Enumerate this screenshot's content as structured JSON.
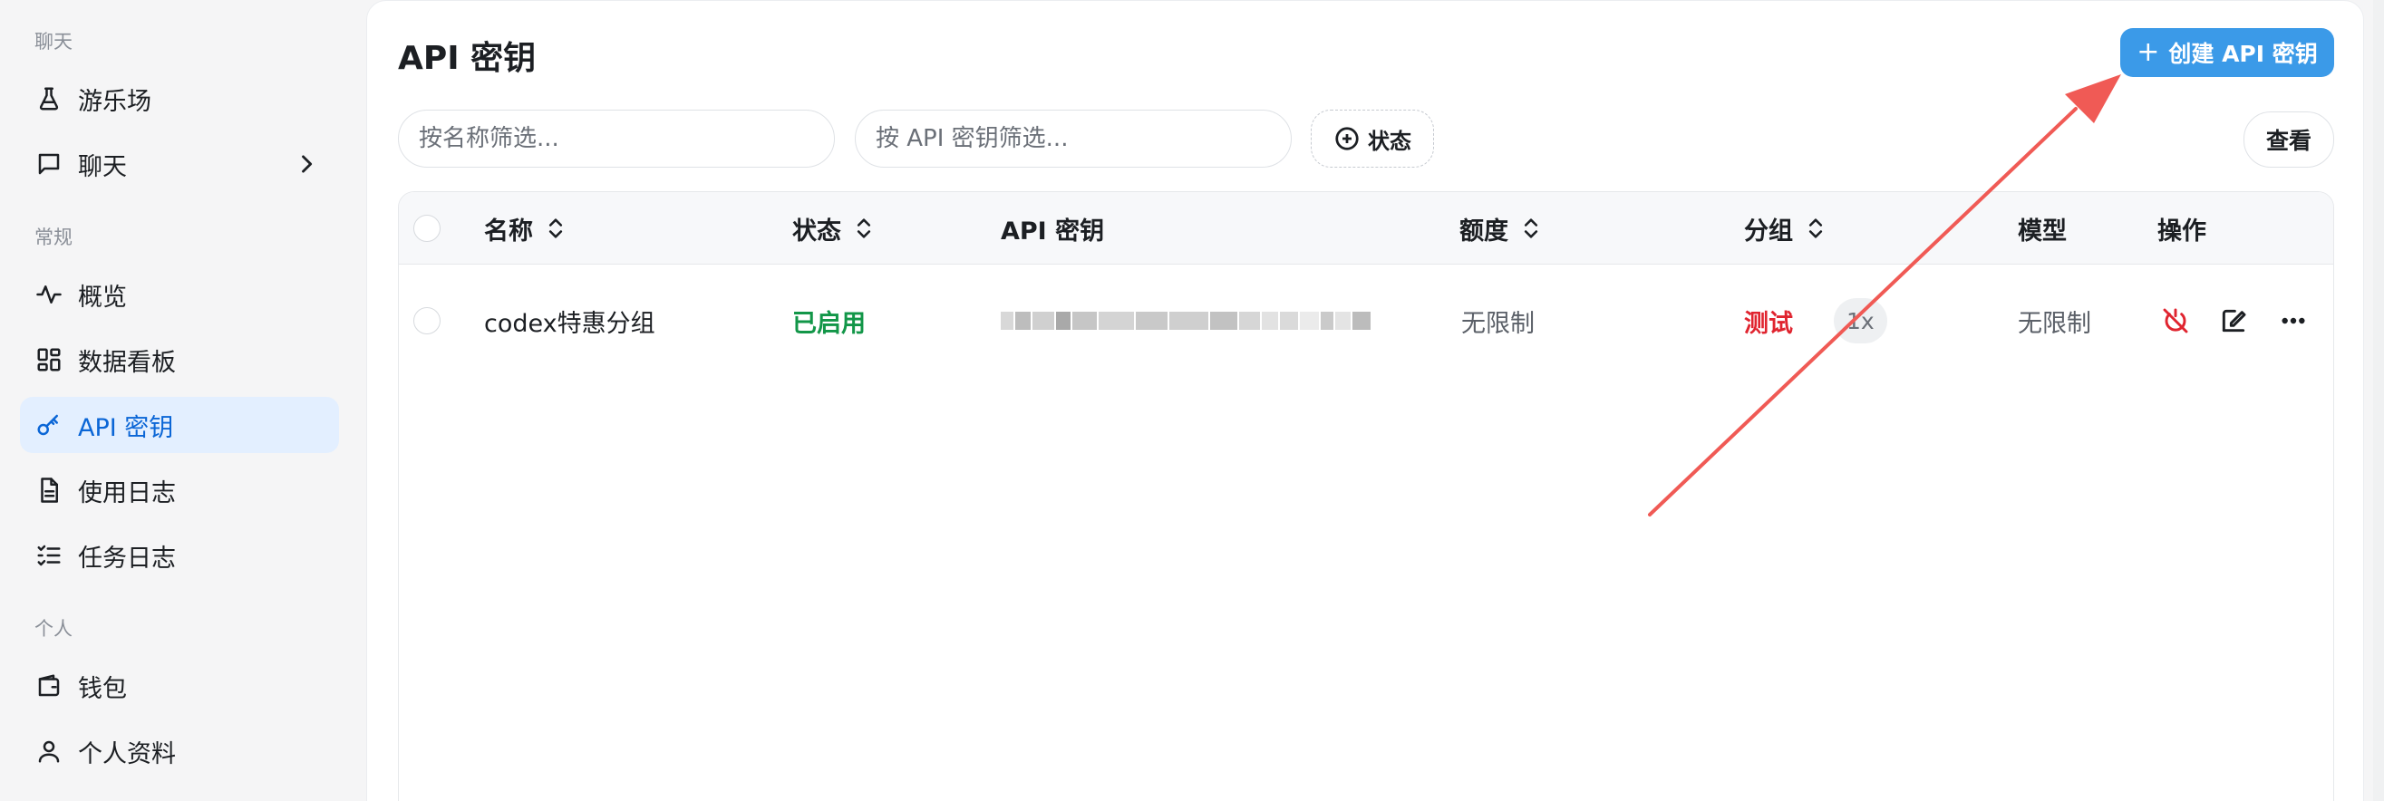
{
  "sidebar": {
    "sections": [
      {
        "label": "聊天"
      },
      {
        "label": "常规"
      },
      {
        "label": "个人"
      }
    ],
    "items": [
      {
        "label": "游乐场",
        "icon": "flask-icon"
      },
      {
        "label": "聊天",
        "icon": "chat-icon"
      },
      {
        "label": "概览",
        "icon": "activity-icon"
      },
      {
        "label": "数据看板",
        "icon": "dashboard-icon"
      },
      {
        "label": "API 密钥",
        "icon": "key-icon",
        "active": true
      },
      {
        "label": "使用日志",
        "icon": "document-icon"
      },
      {
        "label": "任务日志",
        "icon": "list-check-icon"
      },
      {
        "label": "钱包",
        "icon": "wallet-icon"
      },
      {
        "label": "个人资料",
        "icon": "user-icon"
      }
    ]
  },
  "main": {
    "title": "API 密钥",
    "create_label": "创建 API 密钥",
    "filters": {
      "name_placeholder": "按名称筛选...",
      "key_placeholder": "按 API 密钥筛选...",
      "status_label": "状态"
    },
    "view_label": "查看",
    "table": {
      "columns": {
        "name": "名称",
        "status": "状态",
        "key": "API 密钥",
        "quota": "额度",
        "group": "分组",
        "model": "模型",
        "actions": "操作"
      },
      "rows": [
        {
          "name": "codex特惠分组",
          "status": "已启用",
          "quota": "无限制",
          "group": "测试",
          "ratio": "1x",
          "model": "无限制"
        }
      ]
    }
  },
  "colors": {
    "accent": "#3b9ae8",
    "active_text": "#0b66d6",
    "enabled": "#129648",
    "danger": "#e0242f",
    "annotation_arrow": "#f05a55"
  }
}
